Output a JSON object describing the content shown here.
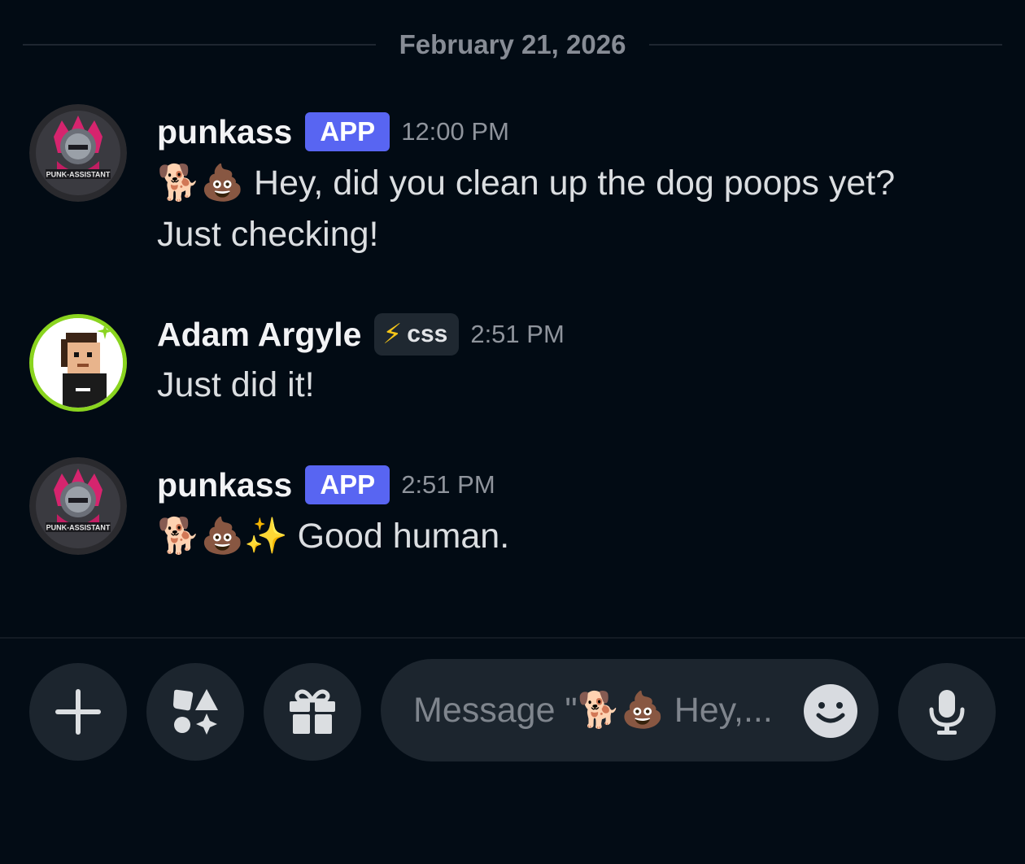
{
  "date_divider": "February 21, 2026",
  "messages": [
    {
      "username": "punkass",
      "badge": "APP",
      "time": "12:00 PM",
      "avatar_text": "PUNK-ASSISTANT",
      "emoji": [
        "🐕",
        "💩"
      ],
      "text_line1": "Hey, did you clean up the dog poops yet?",
      "text_line2": "Just checking!"
    },
    {
      "username": "Adam Argyle",
      "badge": "css",
      "badge_icon": "⚡",
      "time": "2:51 PM",
      "text": "Just did it!"
    },
    {
      "username": "punkass",
      "badge": "APP",
      "time": "2:51 PM",
      "avatar_text": "PUNK-ASSISTANT",
      "emoji": [
        "🐕",
        "💩",
        "✨"
      ],
      "text": "Good human."
    }
  ],
  "composer": {
    "placeholder": "Message \"🐕💩 Hey,..."
  },
  "icons": {
    "add": "plus-icon",
    "apps": "apps-icon",
    "gift": "gift-icon",
    "emoji": "emoji-smile-icon",
    "voice": "microphone-icon"
  },
  "colors": {
    "background": "#020b14",
    "app_badge": "#5865f2",
    "input_bg": "#1c252e"
  }
}
